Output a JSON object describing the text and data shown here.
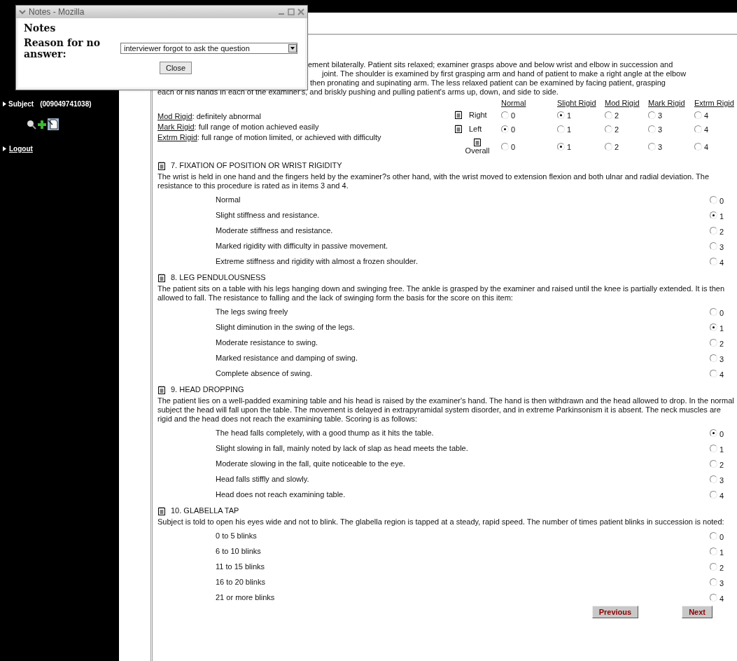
{
  "sidebar": {
    "subject_label": "Subject",
    "subject_id": "(009049741038)",
    "logout": "Logout"
  },
  "rigidity": {
    "description_lines": [
      "ement bilaterally. Patient sits relaxed; examiner grasps above and below wrist and elbow in succession and",
      "joint. The shoulder is examined by first grasping arm and hand of patient to make a right angle at the elbow",
      "then pronating and supinating arm. The less relaxed patient can be examined by facing patient, grasping",
      "each of his hands in each of the examiner's, and briskly pushing and pulling patient's arms up, down, and side to side."
    ],
    "legend": [
      {
        "term": "Mod Rigid",
        "text": ": definitely abnormal"
      },
      {
        "term": "Mark Rigid",
        "text": ": full range of motion achieved easily"
      },
      {
        "term": "Extrm Rigid",
        "text": ": full range of motion limited, or achieved with difficulty"
      }
    ],
    "columns": [
      "Normal",
      "Slight Rigid",
      "Mod Rigid",
      "Mark Rigid",
      "Extrm Rigid"
    ],
    "rows": [
      {
        "label": "Right",
        "options": [
          {
            "value": "0",
            "selected": false
          },
          {
            "value": "1",
            "selected": true
          },
          {
            "value": "2",
            "selected": false
          },
          {
            "value": "3",
            "selected": false
          },
          {
            "value": "4",
            "selected": false
          }
        ]
      },
      {
        "label": "Left",
        "options": [
          {
            "value": "0",
            "selected": true
          },
          {
            "value": "1",
            "selected": false
          },
          {
            "value": "2",
            "selected": false
          },
          {
            "value": "3",
            "selected": false
          },
          {
            "value": "4",
            "selected": false
          }
        ]
      },
      {
        "label": "Overall",
        "options": [
          {
            "value": "0",
            "selected": false
          },
          {
            "value": "1",
            "selected": true
          },
          {
            "value": "2",
            "selected": false
          },
          {
            "value": "3",
            "selected": false
          },
          {
            "value": "4",
            "selected": false
          }
        ]
      }
    ]
  },
  "questions": [
    {
      "title": "7. FIXATION OF POSITION OR WRIST RIGIDITY",
      "description": "The wrist is held in one hand and the fingers held by the examiner?s other hand, with the wrist moved to extension flexion and both ulnar and radial deviation. The resistance to this procedure is rated as in items 3 and 4.",
      "options": [
        {
          "label": "Normal",
          "value": "0",
          "selected": false
        },
        {
          "label": "Slight stiffness and resistance.",
          "value": "1",
          "selected": true
        },
        {
          "label": "Moderate stiffness and resistance.",
          "value": "2",
          "selected": false
        },
        {
          "label": "Marked rigidity with difficulty in passive movement.",
          "value": "3",
          "selected": false
        },
        {
          "label": "Extreme stiffness and rigidity with almost a frozen shoulder.",
          "value": "4",
          "selected": false
        }
      ]
    },
    {
      "title": "8. LEG PENDULOUSNESS",
      "description": "The patient sits on a table with his legs hanging down and swinging free. The ankle is grasped by the examiner and raised until the knee is partially extended. It is then allowed to fall. The resistance to falling and the lack of swinging form the basis for the score on this item:",
      "options": [
        {
          "label": "The legs swing freely",
          "value": "0",
          "selected": false
        },
        {
          "label": "Slight diminution in the swing of the legs.",
          "value": "1",
          "selected": true
        },
        {
          "label": "Moderate resistance to swing.",
          "value": "2",
          "selected": false
        },
        {
          "label": "Marked resistance and damping of swing.",
          "value": "3",
          "selected": false
        },
        {
          "label": "Complete absence of swing.",
          "value": "4",
          "selected": false
        }
      ]
    },
    {
      "title": "9. HEAD DROPPING",
      "description": "The patient lies on a well-padded examining table and his head is raised by the examiner's hand. The hand is then withdrawn and the head allowed to drop. In the normal subject the head will fall upon the table. The movement is delayed in extrapyramidal system disorder, and in extreme Parkinsonism it is absent. The neck muscles are rigid and the head does not reach the examining table. Scoring is as follows:",
      "options": [
        {
          "label": "The head falls completely, with a good thump as it hits the table.",
          "value": "0",
          "selected": true
        },
        {
          "label": "Slight slowing in fall, mainly noted by lack of slap as head meets the table.",
          "value": "1",
          "selected": false
        },
        {
          "label": "Moderate slowing in the fall, quite noticeable to the eye.",
          "value": "2",
          "selected": false
        },
        {
          "label": "Head falls stiffly and slowly.",
          "value": "3",
          "selected": false
        },
        {
          "label": "Head does not reach examining table.",
          "value": "4",
          "selected": false
        }
      ]
    },
    {
      "title": "10. GLABELLA TAP",
      "description": "Subject is told to open his eyes wide and not to blink. The glabella region is tapped at a steady, rapid speed. The number of times patient blinks in succession is noted:",
      "options": [
        {
          "label": "0 to 5 blinks",
          "value": "0",
          "selected": false
        },
        {
          "label": "6 to 10 blinks",
          "value": "1",
          "selected": false
        },
        {
          "label": "11 to 15 blinks",
          "value": "2",
          "selected": false
        },
        {
          "label": "16 to 20 blinks",
          "value": "3",
          "selected": false
        },
        {
          "label": "21 or more blinks",
          "value": "4",
          "selected": false
        }
      ]
    }
  ],
  "buttons": {
    "previous": "Previous",
    "next": "Next"
  },
  "popup": {
    "title": "Notes - Mozilla",
    "heading": "Notes",
    "reason_label": "Reason for no answer:",
    "reason_value": "interviewer forgot to ask the question",
    "close": "Close"
  }
}
